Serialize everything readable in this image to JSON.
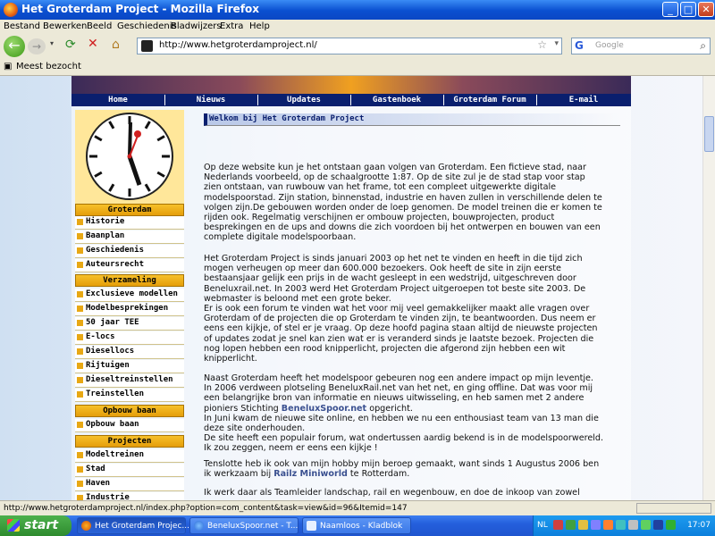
{
  "window": {
    "title": "Het Groterdam Project - Mozilla Firefox",
    "controls": {
      "minimize": "_",
      "maximize": "□",
      "close": "✕"
    }
  },
  "menu": [
    "Bestand",
    "Bewerken",
    "Beeld",
    "Geschiedenis",
    "Bladwijzers",
    "Extra",
    "Help"
  ],
  "toolbar": {
    "url": "http://www.hetgroterdamproject.nl/",
    "search_placeholder": "Google"
  },
  "bookmarks": {
    "items": [
      "Meest bezocht"
    ]
  },
  "site": {
    "nav": [
      "Home",
      "Nieuws",
      "Updates",
      "Gastenboek",
      "Groterdam Forum",
      "E-mail"
    ],
    "sidebar": {
      "sections": [
        {
          "title": "Groterdam",
          "items": [
            "Historie",
            "Baanplan",
            "Geschiedenis",
            "Auteursrecht"
          ]
        },
        {
          "title": "Verzameling",
          "items": [
            "Exclusieve modellen",
            "Modelbesprekingen",
            "50 jaar TEE",
            "E-locs",
            "Diesellocs",
            "Rijtuigen",
            "Dieseltreinstellen",
            "Treinstellen"
          ]
        },
        {
          "title": "Opbouw baan",
          "items": [
            "Opbouw baan"
          ]
        },
        {
          "title": "Projecten",
          "items": [
            "Modeltreinen",
            "Stad",
            "Haven",
            "Industrie"
          ]
        }
      ]
    },
    "welcome_title": "Welkom bij Het Groterdam Project",
    "paragraphs": [
      [
        "Op deze website kun je het ontstaan gaan volgen van Groterdam. Een fictieve stad, naar",
        "Nederlands voorbeeld, op de schaalgrootte 1:87. Op de site zul je de stad stap voor stap",
        "zien ontstaan, van ruwbouw van het frame, tot een compleet uitgewerkte digitale",
        "modelspoorstad. Zijn station, binnenstad, industrie en haven zullen in verschillende delen te",
        "volgen zijn.De gebouwen worden onder de loep genomen. De model treinen die er komen te",
        "rijden ook. Regelmatig verschijnen er ombouw projecten, bouwprojecten, product",
        "besprekingen en de ups and downs die zich voordoen bij het ontwerpen en bouwen van een",
        "complete digitale modelspoorbaan."
      ],
      [
        "Het Groterdam Project is sinds januari 2003 op het net te vinden en heeft in die tijd zich",
        "mogen verheugen op meer dan 600.000 bezoekers. Ook heeft de site in zijn eerste",
        "bestaansjaar gelijk een prijs in de wacht gesleept in een wedstrijd, uitgeschreven door",
        "Beneluxrail.net. In 2003 werd Het Groterdam Project uitgeroepen tot beste site 2003. De",
        "webmaster is beloond met een grote beker."
      ],
      [
        "Er is ook een forum te vinden wat het voor mij veel gemakkelijker maakt alle vragen over",
        "Groterdam of de projecten die op Groterdam te vinden zijn, te beantwoorden. Dus neem er",
        "eens een kijkje, of stel er je vraag. Op deze hoofd pagina staan altijd de nieuwste projecten",
        "of updates zodat je snel kan zien wat er is veranderd sinds je laatste bezoek. Projecten die",
        "nog lopen hebben een rood knipperlicht, projecten die afgerond zijn hebben een wit",
        "knipperlicht."
      ],
      [
        "Naast Groterdam heeft het modelspoor gebeuren nog een andere impact op mijn leventje.",
        "In 2006 verdween plotseling BeneluxRail.net van het net, en ging offline. Dat was voor mij",
        "een belangrijke bron van informatie en nieuws uitwisseling, en heb samen met 2 andere",
        "pioniers Stichting "
      ],
      [
        "In Juni kwam de nieuwe site online, en hebben we nu een enthousiast team van 13 man die",
        "deze site onderhouden.",
        "De site heeft een populair forum, wat ondertussen aardig bekend is in de modelspoorwereld.",
        "Ik zou zeggen, neem er eens een kijkje !"
      ],
      [
        "Tenslotte heb ik ook van mijn hobby mijn beroep gemaakt, want sinds 1 Augustus 2006 ben",
        "ik werkzaam bij "
      ],
      [
        "Ik werk daar als Teamleider landschap, rail en wegenbouw, en doe de inkoop van zowel"
      ]
    ],
    "inline": {
      "benelux_link": "BeneluxSpoor.net",
      "benelux_after": " opgericht.",
      "railz_link": "Railz Miniworld",
      "railz_after": " te Rotterdam."
    }
  },
  "status": {
    "text": "http://www.hetgroterdamproject.nl/index.php?option=com_content&task=view&id=96&Itemid=147"
  },
  "taskbar": {
    "start": "start",
    "tasks": [
      "Het Groterdam Projec...",
      "BeneluxSpoor.net - T...",
      "Naamloos - Kladblok"
    ],
    "lang": "NL",
    "time": "17:07"
  },
  "colors": {
    "nav": "#0a1f6e",
    "sidebar_header": "#f0b21e",
    "accent": "#e8a814"
  }
}
